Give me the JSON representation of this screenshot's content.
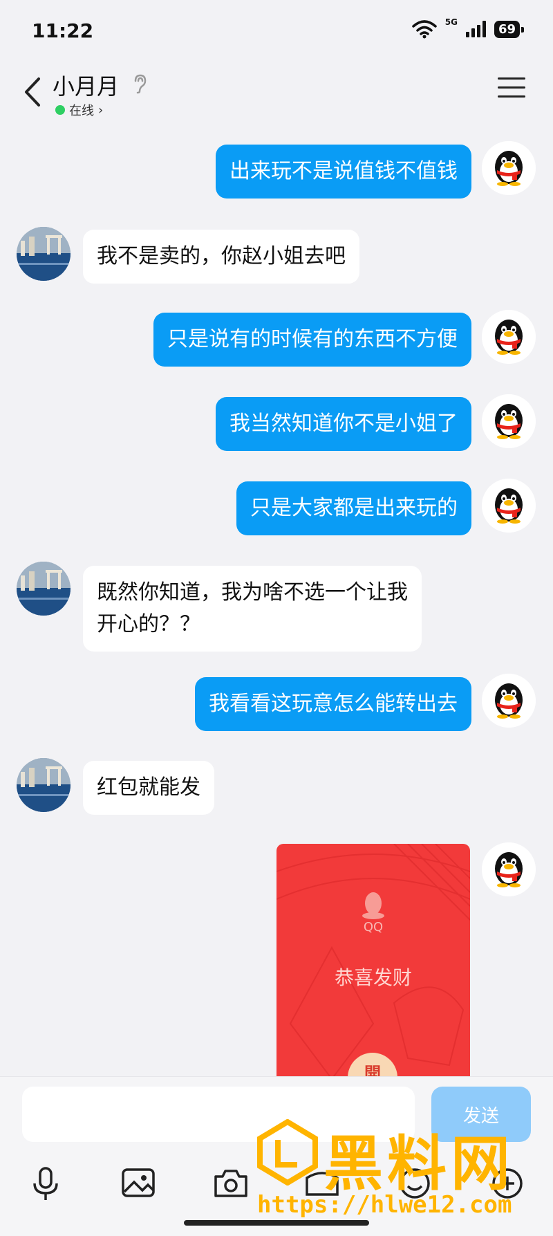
{
  "status_bar": {
    "time": "11:22",
    "network": "5G",
    "battery": "69"
  },
  "header": {
    "name": "小月月",
    "status": "在线",
    "status_arrow": "›"
  },
  "messages": [
    {
      "side": "out",
      "text": "出来玩不是说值钱不值钱"
    },
    {
      "side": "in",
      "text": "我不是卖的，你赵小姐去吧"
    },
    {
      "side": "out",
      "text": "只是说有的时候有的东西不方便"
    },
    {
      "side": "out",
      "text": "我当然知道你不是小姐了"
    },
    {
      "side": "out",
      "text": "只是大家都是出来玩的"
    },
    {
      "side": "in",
      "text_line1": "既然你知道，我为啥不选一个让我",
      "text_line2": "开心的？？"
    },
    {
      "side": "out",
      "text": "我看看这玩意怎么能转出去"
    },
    {
      "side": "in",
      "text": "红包就能发"
    }
  ],
  "red_packet": {
    "brand": "QQ",
    "title": "恭喜发财",
    "open_label": "開"
  },
  "input": {
    "placeholder": "",
    "send_label": "发送"
  },
  "toolbar": {
    "icons": [
      "microphone-icon",
      "image-icon",
      "camera-icon",
      "red-packet-icon",
      "emoji-icon",
      "plus-icon"
    ]
  },
  "watermark": {
    "text": "黑料网",
    "url": "https://hlwe12.com"
  },
  "colors": {
    "bubble_out": "#0a9cf5",
    "bubble_in": "#ffffff",
    "background": "#f2f2f5",
    "red_packet": "#f23a3a"
  }
}
